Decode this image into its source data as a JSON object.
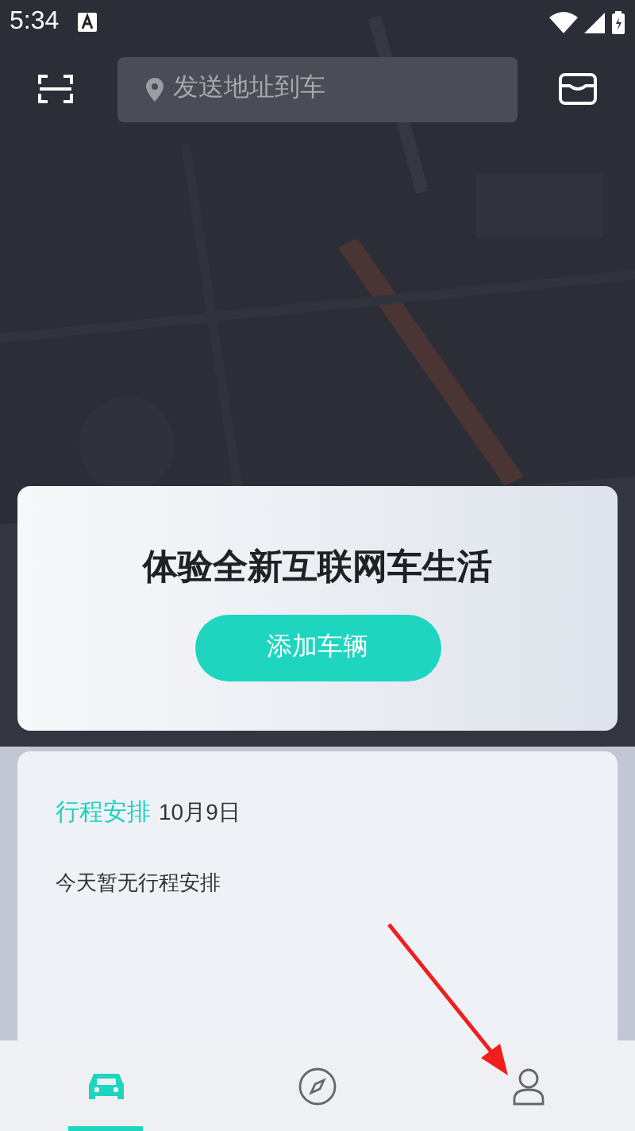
{
  "status_bar": {
    "time": "5:34"
  },
  "search": {
    "placeholder": "发送地址到车"
  },
  "promo_card": {
    "title": "体验全新互联网车生活",
    "button": "添加车辆"
  },
  "schedule_card": {
    "title": "行程安排",
    "date": "10月9日",
    "empty_text": "今天暂无行程安排"
  },
  "bottom_nav": [
    {
      "kind": "car",
      "selected": true
    },
    {
      "kind": "compass",
      "selected": false
    },
    {
      "kind": "person",
      "selected": false
    }
  ]
}
